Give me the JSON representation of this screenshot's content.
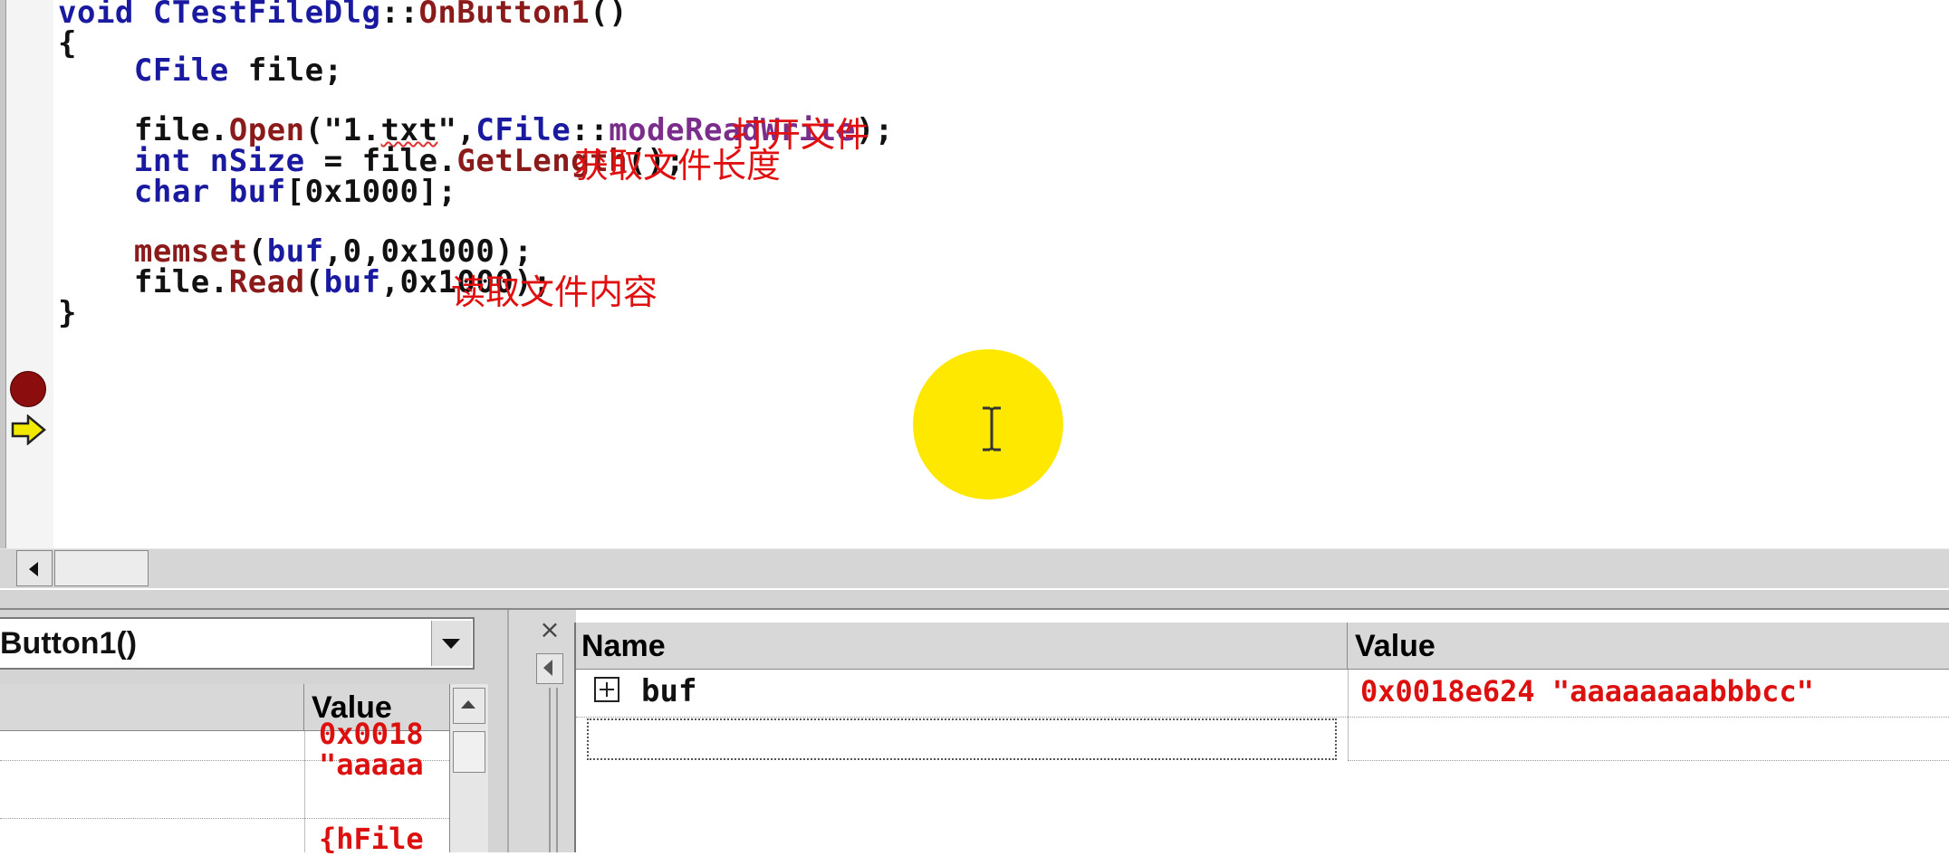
{
  "editor": {
    "lines": [
      {
        "parts": [
          [
            "kw",
            "void "
          ],
          [
            "cls",
            "CTestFileDlg"
          ],
          [
            "",
            "::"
          ],
          [
            "fn",
            "OnButton1"
          ],
          [
            "",
            "()"
          ]
        ]
      },
      {
        "parts": [
          [
            "",
            "{"
          ]
        ]
      },
      {
        "parts": [
          [
            "",
            "    "
          ],
          [
            "cls",
            "CFile"
          ],
          [
            "",
            " file;"
          ]
        ]
      },
      {
        "parts": [
          [
            "",
            ""
          ]
        ]
      },
      {
        "parts": [
          [
            "",
            "    file."
          ],
          [
            "fn",
            "Open"
          ],
          [
            "",
            "(\"1."
          ],
          [
            "sq",
            "txt"
          ],
          [
            "",
            "\","
          ],
          [
            "cls",
            "CFile"
          ],
          [
            "",
            "::"
          ],
          [
            "enum",
            "modeReadWrite"
          ],
          [
            "",
            ");"
          ]
        ]
      },
      {
        "parts": [
          [
            "",
            "    "
          ],
          [
            "kw",
            "int"
          ],
          [
            "",
            " "
          ],
          [
            "var",
            "nSize"
          ],
          [
            "",
            " = file."
          ],
          [
            "fn",
            "GetLength"
          ],
          [
            "",
            "();"
          ]
        ]
      },
      {
        "parts": [
          [
            "",
            "    "
          ],
          [
            "kw",
            "char"
          ],
          [
            "",
            " "
          ],
          [
            "var",
            "buf"
          ],
          [
            "",
            "[0x1000];"
          ]
        ]
      },
      {
        "parts": [
          [
            "",
            ""
          ]
        ]
      },
      {
        "parts": [
          [
            "",
            "    "
          ],
          [
            "fn",
            "memset"
          ],
          [
            "",
            "("
          ],
          [
            "var",
            "buf"
          ],
          [
            "",
            ",0,0x1000);"
          ]
        ]
      },
      {
        "parts": [
          [
            "",
            "    file."
          ],
          [
            "fn",
            "Read"
          ],
          [
            "",
            "("
          ],
          [
            "var",
            "buf"
          ],
          [
            "",
            ",0x1000);"
          ]
        ]
      },
      {
        "parts": [
          [
            "",
            "}"
          ]
        ]
      }
    ],
    "annotations": {
      "open_file": "打开文件",
      "get_length": "获取文件长度",
      "read_content": "读取文件内容"
    }
  },
  "variables": {
    "context": "Button1()",
    "value_header": "Value",
    "values": [
      "0x0018",
      "\"aaaaa",
      "{hFile"
    ]
  },
  "watch": {
    "close_glyph": "×",
    "name_header": "Name",
    "value_header": "Value",
    "rows": [
      {
        "name": "buf",
        "value": "0x0018e624 \"aaaaaaaabbbcc\""
      }
    ]
  },
  "colors": {
    "annotation": "#e01010",
    "keyword": "#1a1aa0",
    "function": "#8b1a1a",
    "enum": "#7b2d8b",
    "debug_value": "#dd1010",
    "breakpoint": "#8b0d0d",
    "cursor_highlight": "#ffe800"
  },
  "icons": {
    "breakpoint": "breakpoint-icon",
    "current_line": "current-line-arrow-icon",
    "cursor": "ibeam-cursor-icon",
    "expand": "plus-box-icon",
    "close": "close-icon"
  }
}
